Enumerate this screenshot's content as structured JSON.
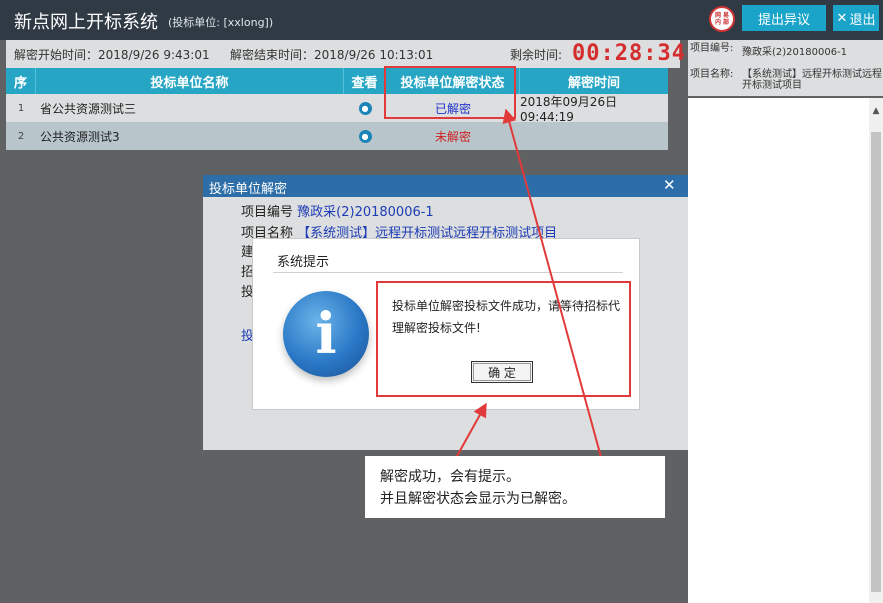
{
  "header": {
    "title": "新点网上开标系统",
    "unit_label": "(投标单位: [xxlong])",
    "logo_text": "网 易 内 部",
    "objection_button": "提出异议",
    "exit_button": "退出"
  },
  "time_bar": {
    "start": "解密开始时间：2018/9/26 9:43:01",
    "end": "解密结束时间：2018/9/26 10:13:01",
    "remain_label": "剩余时间:",
    "countdown": "00:28:34"
  },
  "table": {
    "headers": [
      "序",
      "投标单位名称",
      "查看",
      "投标单位解密状态",
      "解密时间"
    ],
    "rows": [
      {
        "index": "1",
        "name": "省公共资源测试三",
        "status": "已解密",
        "time": "2018年09月26日 09:44:19"
      },
      {
        "index": "2",
        "name": "公共资源测试3",
        "status": "未解密",
        "time": ""
      }
    ]
  },
  "right_panel": {
    "project_no_key": "项目编号:",
    "project_no_val": "豫政采(2)20180006-1",
    "project_name_key": "项目名称:",
    "project_name_val": "【系统测试】远程开标测试远程开标测试项目",
    "scroll_up": "▲"
  },
  "decrypt_dialog": {
    "title": "投标单位解密",
    "close": "✕",
    "project_no_label": "项目编号",
    "project_no_value": "豫政采(2)20180006-1",
    "project_name_label": "项目名称",
    "project_name_value": "【系统测试】远程开标测试远程开标测试项目",
    "line3": "建",
    "line4": "招",
    "line5": "投",
    "link": "投"
  },
  "system_tip": {
    "title": "系统提示",
    "message": "投标单位解密投标文件成功，请等待招标代理解密投标文件!",
    "ok_button": "确 定"
  },
  "annotation": {
    "line1": "解密成功，会有提示。",
    "line2": "并且解密状态会显示为已解密。",
    "color": "#e23a3a"
  }
}
